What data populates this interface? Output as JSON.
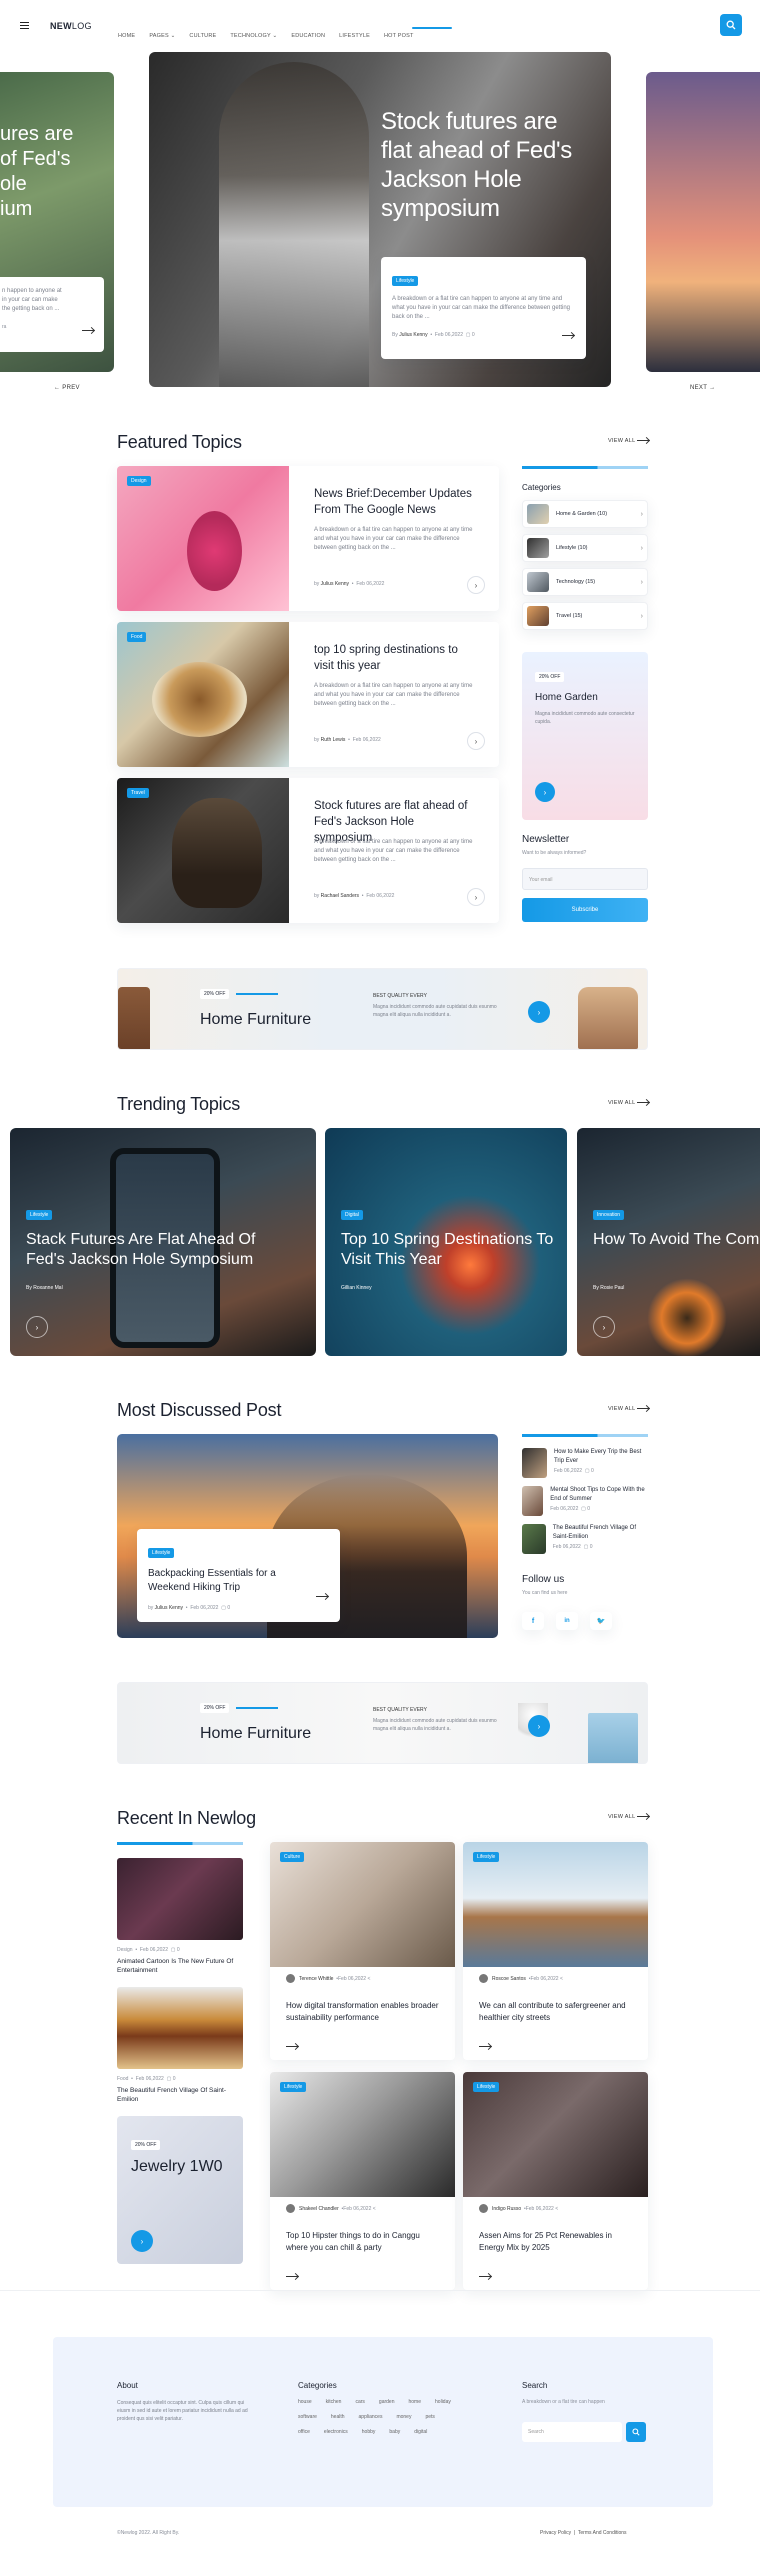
{
  "header": {
    "logo_bold": "NEW",
    "logo_light": "LOG",
    "nav": [
      "HOME",
      "PAGES",
      "CULTURE",
      "TECHNOLOGY",
      "EDUCATION",
      "LIFESTYLE",
      "HOT POST"
    ],
    "menu_icon": "hamburger-icon",
    "search_icon": "search-icon"
  },
  "hero": {
    "left_title": "ures are\nof Fed's\nole\nium",
    "left_excerpt": "n happen to anyone at\nin your car can make\nthe getting back on ...",
    "left_author": "ra",
    "main_title": "Stock futures are flat ahead of Fed's Jackson Hole symposium",
    "main_tag": "Lifestyle",
    "main_excerpt": "A breakdown or a flat tire can happen to anyone at any time and what you have in your car can make the difference between getting back on the ...",
    "main_author": "Julius Kenny",
    "main_date": "Feb 06,2022",
    "main_comments": "0",
    "prev": "PREV",
    "next": "NEXT"
  },
  "featured": {
    "title": "Featured Topics",
    "view_all": "VIEW ALL",
    "posts": [
      {
        "tag": "Design",
        "title": "News Brief:December Updates From The Google News",
        "excerpt": "A breakdown or a flat tire can happen to anyone at any time and what you have in your car can make the difference between getting back on the ...",
        "author": "Julius Kenny",
        "date": "Feb 06,2022"
      },
      {
        "tag": "Food",
        "title": "top 10 spring destinations to visit this year",
        "excerpt": "A breakdown or a flat tire can happen to anyone at any time and what you have in your car can make the difference between getting back on the ...",
        "author": "Ruth Lewis",
        "date": "Feb 06,2022"
      },
      {
        "tag": "Travel",
        "title": "Stock futures are flat ahead of Fed's Jackson Hole symposium",
        "excerpt": "A breakdown or a flat tire can happen to anyone at any time and what you have in your car can make the difference between getting back on the ...",
        "author": "Rachael Sanders",
        "date": "Feb 06,2022"
      }
    ]
  },
  "sidebar": {
    "categories_title": "Categories",
    "categories": [
      {
        "name": "Home & Garden",
        "count": "(10)"
      },
      {
        "name": "Lifestyle",
        "count": "(10)"
      },
      {
        "name": "Technology",
        "count": "(15)"
      },
      {
        "name": "Travel",
        "count": "(15)"
      }
    ],
    "promo_badge": "20% OFF",
    "promo_title": "Home Garden",
    "promo_text": "Magna incididunt commodo aute consectetur cupida.",
    "newsletter_title": "Newsletter",
    "newsletter_sub": "Want to be always informed?",
    "newsletter_placeholder": "Your email",
    "newsletter_button": "Subscribe"
  },
  "banner1": {
    "badge": "20% OFF",
    "title": "Home Furniture",
    "label": "BEST QUALITY EVERY",
    "text": "Magna incididunt commodo aute cupidatat duis esunmo magna elit aliqua nulla incididunt a."
  },
  "trending": {
    "title": "Trending Topics",
    "view_all": "VIEW ALL",
    "items": [
      {
        "tag": "Lifestyle",
        "title": "Stack Futures Are Flat Ahead Of Fed's Jackson Hole Symposium",
        "author": "By Roxanne Mal"
      },
      {
        "tag": "Digital",
        "title": "Top 10 Spring Destinations To Visit This Year",
        "author": "Gillian Kinney"
      },
      {
        "tag": "Innovation",
        "title": "How To Avoid The Comparison Game",
        "author": "By Rosie Paul"
      }
    ]
  },
  "discussed": {
    "title": "Most Discussed Post",
    "view_all": "VIEW ALL",
    "main_tag": "Lifestyle",
    "main_title": "Backpacking Essentials for a Weekend Hiking Trip",
    "main_author": "Julius Kenny",
    "main_date": "Feb 06,2022",
    "main_comments": "0",
    "side": [
      {
        "title": "How to Make Every Trip the Best Trip Ever",
        "date": "Feb 06,2022",
        "comments": "0"
      },
      {
        "title": "Mental Shoot Tips to Cope With the End of Summer",
        "date": "Feb 06,2022",
        "comments": "0"
      },
      {
        "title": "The Beautiful French Village Of Saint-Emilion",
        "date": "Feb 06,2022",
        "comments": "0"
      }
    ],
    "follow_title": "Follow us",
    "follow_sub": "You can find us here"
  },
  "banner2": {
    "badge": "20% OFF",
    "title": "Home Furniture",
    "label": "BEST QUALITY EVERY",
    "text": "Magna incididunt commodo aute cupidatat duis esunmo magna elit aliqua nulla incididunt a."
  },
  "recent": {
    "title": "Recent In Newlog",
    "view_all": "VIEW ALL",
    "left": [
      {
        "cat": "Design",
        "date": "Feb 06,2022",
        "comments": "0",
        "title": "Animated Cartoon Is The New Future Of Entertainment"
      },
      {
        "cat": "Food",
        "date": "Feb 06,2022",
        "comments": "0",
        "title": "The Beautiful French Village Of Saint-Emilion"
      }
    ],
    "jewel_badge": "20% OFF",
    "jewel_title": "Jewelry 1W0",
    "grid": [
      {
        "tag": "Culture",
        "author": "Terence Whittle",
        "date": "Feb 06,2022",
        "title": "How digital transformation enables broader sustainability performance"
      },
      {
        "tag": "Lifestyle",
        "author": "Roscoe Santos",
        "date": "Feb 06,2022",
        "title": "We can all contribute to safergreener and healthier city streets"
      },
      {
        "tag": "Lifestyle",
        "author": "Shakeel Chandler",
        "date": "Feb 06,2022",
        "title": "Top 10 Hipster things to do in Canggu where you can chill & party"
      },
      {
        "tag": "Lifestyle",
        "author": "Indigo Russo",
        "date": "Feb 06,2022",
        "title": "Assen Aims for 25 Pct Renewables in Energy Mix by 2025"
      }
    ]
  },
  "footer": {
    "about_title": "About",
    "about_text": "Consequat quis elitelit occaptur sint. Culpa quis cillum qui eiusm in sed id aute et lorem pariatur incididunt nulla ad ad proident qus sisi velit pariatur.",
    "categories_title": "Categories",
    "tags": [
      "house",
      "kitchen",
      "cars",
      "garden",
      "home",
      "holiday",
      "software",
      "health",
      "appliances",
      "money",
      "pets",
      "office",
      "electronics",
      "hobby",
      "baby",
      "digital"
    ],
    "search_title": "Search",
    "search_sub": "A breakdown or a flat tire can happen",
    "search_placeholder": "Search",
    "copyright": "Newlog 2022. All Right By.",
    "privacy": "Privacy Policy",
    "terms": "Terms And Conditions"
  },
  "colors": {
    "accent": "#1499e6",
    "dark": "#1c2230",
    "footer_bg": "#eef3fd"
  }
}
